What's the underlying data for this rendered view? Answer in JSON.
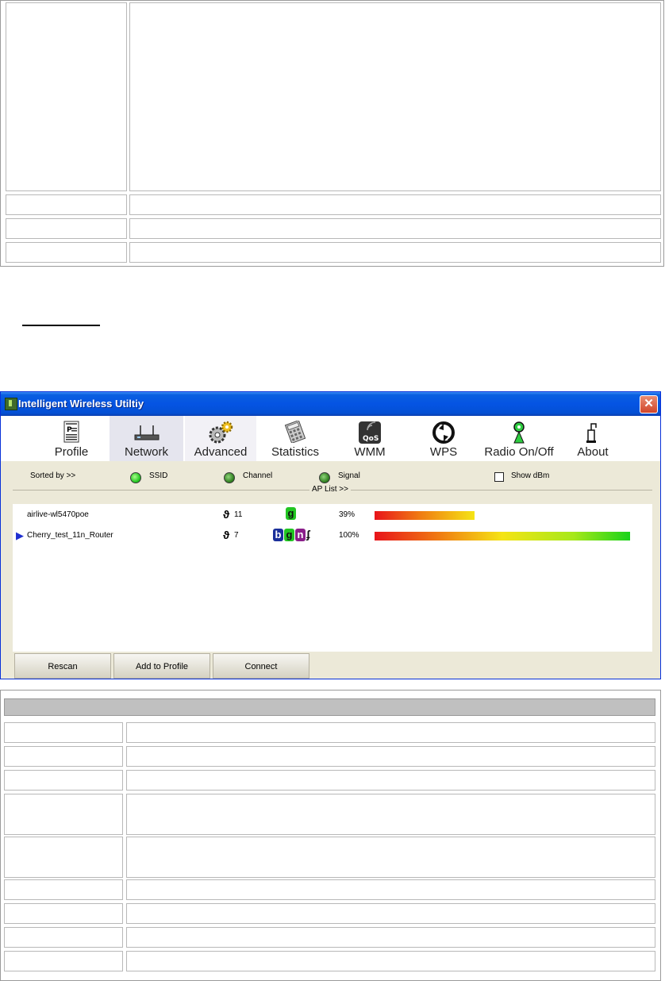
{
  "window": {
    "title": "Intelligent Wireless Utiltiy",
    "close_label": "✕"
  },
  "toolbar": {
    "items": [
      {
        "label": "Profile",
        "icon": "profile-icon"
      },
      {
        "label": "Network",
        "icon": "network-icon",
        "active": true
      },
      {
        "label": "Advanced",
        "icon": "gear-icon"
      },
      {
        "label": "Statistics",
        "icon": "calculator-icon"
      },
      {
        "label": "WMM",
        "icon": "qos-icon"
      },
      {
        "label": "WPS",
        "icon": "wps-icon"
      },
      {
        "label": "Radio On/Off",
        "icon": "radio-antenna-icon"
      },
      {
        "label": "About",
        "icon": "about-icon"
      }
    ]
  },
  "sort": {
    "label": "Sorted by >>",
    "options": [
      {
        "label": "SSID",
        "selected": true
      },
      {
        "label": "Channel",
        "selected": false
      },
      {
        "label": "Signal",
        "selected": false
      }
    ],
    "show_dbm_label": "Show dBm",
    "show_dbm_checked": false
  },
  "ap_list": {
    "header": "AP List >>",
    "rows": [
      {
        "ssid": "airlive-wl5470poe",
        "channel": "11",
        "modes": [
          "g"
        ],
        "signal_text": "39%",
        "signal": 0.39,
        "selected": false
      },
      {
        "ssid": "Cherry_test_11n_Router",
        "channel": "7",
        "modes": [
          "b",
          "g",
          "n"
        ],
        "wps": true,
        "signal_text": "100%",
        "signal": 1.0,
        "selected": true
      }
    ]
  },
  "buttons": {
    "rescan": "Rescan",
    "add_to_profile": "Add to Profile",
    "connect": "Connect"
  },
  "colors": {
    "title_bar": "#0554e3",
    "mode_b": "#1a2f9a",
    "mode_g": "#22c522",
    "mode_n": "#8a1f8a"
  }
}
